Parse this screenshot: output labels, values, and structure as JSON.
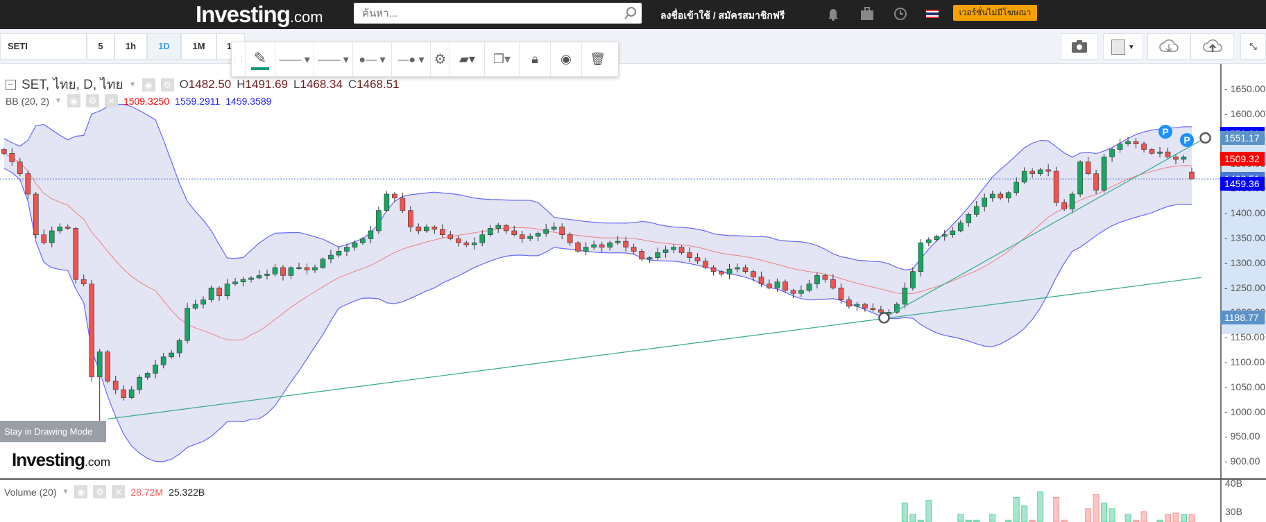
{
  "header": {
    "logo": "Investing",
    "logo_suffix": ".com",
    "search_placeholder": "ค้นหา...",
    "login": "ลงชื่อเข้าใช้ / สมัครสมาชิกฟรี",
    "adfree": "เวอร์ชั่นไม่มีโฆษณา"
  },
  "toolbar": {
    "symbol": "SETI",
    "intervals": [
      "5",
      "1h",
      "1D",
      "1M",
      "1!"
    ],
    "active_interval": "1D"
  },
  "legend": {
    "title": "SET, ไทย, D, ไทย",
    "o_label": "O",
    "o": "1482.50",
    "h_label": "H",
    "h": "1491.69",
    "l_label": "L",
    "l": "1468.34",
    "c_label": "C",
    "c": "1468.51",
    "bb": "BB (20, 2)",
    "bb_mid": "1509.3250",
    "bb_up": "1559.2911",
    "bb_low": "1459.3589"
  },
  "volume": {
    "label": "Volume (20)",
    "v1": "28.72M",
    "v2": "25.322B",
    "ticks": [
      "40B",
      "30B"
    ]
  },
  "drawing_mode": "Stay in Drawing Mode",
  "watermark": "Investing",
  "watermark_suffix": ".com",
  "axis_ticks": [
    "1650.00",
    "1600.00",
    "1550.00",
    "1500.00",
    "1450.00",
    "1400.00",
    "1350.00",
    "1300.00",
    "1250.00",
    "1200.00",
    "1150.00",
    "1100.00",
    "1050.00",
    "1000.00",
    "950.00",
    "900.00"
  ],
  "price_tags": [
    {
      "v": "1559.29",
      "color": "#0000ff"
    },
    {
      "v": "1551.17",
      "color": "#5b92c8"
    },
    {
      "v": "1509.32",
      "color": "#ff0000"
    },
    {
      "v": "1468.51",
      "color": "#4a78d4"
    },
    {
      "v": "1459.36",
      "color": "#0000ff"
    },
    {
      "v": "1188.77",
      "color": "#5b92c8"
    }
  ],
  "colors": {
    "up": "#1ba463",
    "down": "#f05350",
    "bb_band": "#6666ff",
    "bb_mid": "#f08080",
    "trend": "#3fae8f"
  },
  "markers": [
    "P",
    "P"
  ],
  "chart_data": {
    "type": "candlestick",
    "ylim": [
      880,
      1670
    ],
    "last_bar": {
      "o": 1482.5,
      "h": 1491.69,
      "l": 1468.34,
      "c": 1468.51
    },
    "closes": [
      1520,
      1503,
      1479,
      1438,
      1356,
      1340,
      1364,
      1372,
      1369,
      1266,
      1257,
      1070,
      1120,
      1061,
      1044,
      1028,
      1044,
      1069,
      1077,
      1094,
      1110,
      1118,
      1143,
      1208,
      1216,
      1225,
      1249,
      1233,
      1257,
      1261,
      1266,
      1269,
      1274,
      1277,
      1290,
      1274,
      1290,
      1290,
      1285,
      1290,
      1307,
      1315,
      1323,
      1331,
      1340,
      1348,
      1364,
      1405,
      1438,
      1430,
      1405,
      1372,
      1364,
      1372,
      1367,
      1356,
      1348,
      1340,
      1336,
      1340,
      1356,
      1369,
      1375,
      1364,
      1356,
      1348,
      1353,
      1359,
      1367,
      1372,
      1356,
      1340,
      1323,
      1331,
      1336,
      1331,
      1340,
      1343,
      1331,
      1323,
      1307,
      1310,
      1320,
      1326,
      1331,
      1320,
      1310,
      1303,
      1290,
      1282,
      1277,
      1287,
      1290,
      1282,
      1271,
      1257,
      1249,
      1261,
      1244,
      1238,
      1244,
      1257,
      1274,
      1266,
      1249,
      1225,
      1212,
      1216,
      1208,
      1205,
      1200,
      1200,
      1216,
      1249,
      1282,
      1340,
      1346,
      1353,
      1356,
      1364,
      1380,
      1397,
      1413,
      1430,
      1438,
      1430,
      1441,
      1462,
      1484,
      1479,
      1487,
      1484,
      1421,
      1408,
      1438,
      1503,
      1479,
      1446,
      1513,
      1528,
      1539,
      1544,
      1539,
      1528,
      1520,
      1523,
      1513,
      1508,
      1513,
      1468.51
    ],
    "volume_b_last40": [
      22,
      24,
      25,
      33,
      29,
      27,
      34,
      20,
      22,
      24,
      29,
      27,
      27,
      22,
      29,
      24,
      27,
      35,
      32,
      27,
      37,
      26,
      35,
      27,
      24,
      22,
      31,
      36,
      33,
      31,
      23,
      29,
      27,
      30,
      24,
      27,
      29,
      29.5,
      29,
      29
    ],
    "trend_lines": [
      {
        "from_bar": 13,
        "from_price": 985,
        "to_bar": 150.2,
        "to_price": 1270
      },
      {
        "from_bar": 110.4,
        "from_price": 1188.77,
        "to_bar": 150.7,
        "to_price": 1551.17
      }
    ],
    "last_price_line": 1468.51
  }
}
